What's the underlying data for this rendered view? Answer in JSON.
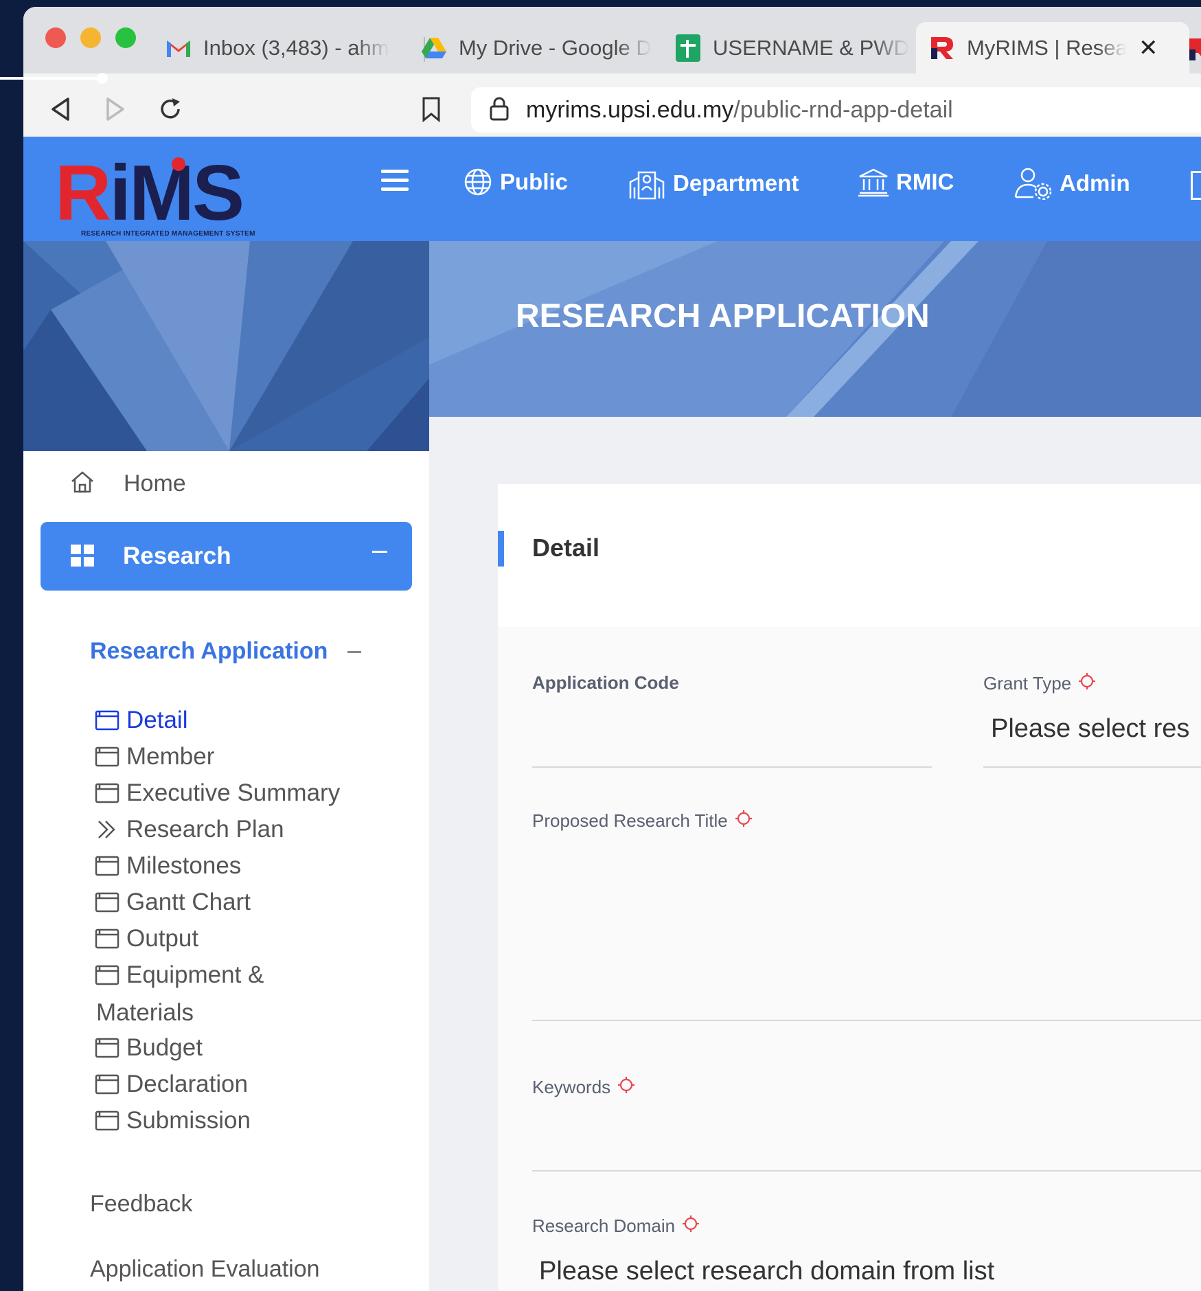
{
  "browser": {
    "tabs": [
      {
        "label": "Inbox (3,483) - ahm",
        "icon": "gmail-icon",
        "active": false
      },
      {
        "label": "My Drive - Google D",
        "icon": "google-drive-icon",
        "active": false
      },
      {
        "label": "USERNAME & PWD",
        "icon": "google-sheets-icon",
        "active": false
      },
      {
        "label": "MyRIMS | Resea",
        "icon": "rims-icon",
        "active": true
      }
    ],
    "url_host": "myrims.upsi.edu.my",
    "url_path": "/public-rnd-app-detail"
  },
  "header": {
    "logo_text_r": "R",
    "logo_text_rest": "iMS",
    "logo_subtitle": "RESEARCH INTEGRATED MANAGEMENT SYSTEM",
    "nav": [
      {
        "label": "Public",
        "icon": "globe-icon"
      },
      {
        "label": "Department",
        "icon": "department-icon"
      },
      {
        "label": "RMIC",
        "icon": "bank-icon"
      },
      {
        "label": "Admin",
        "icon": "admin-user-icon"
      }
    ],
    "brand_color": "#4287ef"
  },
  "hero": {
    "title": "RESEARCH APPLICATION"
  },
  "sidebar": {
    "home": "Home",
    "research": "Research",
    "research_application": "Research Application",
    "items": [
      {
        "label": "Detail",
        "active": true
      },
      {
        "label": "Member"
      },
      {
        "label": "Executive Summary"
      },
      {
        "label": "Research Plan",
        "icon": "double-chevron-icon"
      },
      {
        "label": "Milestones"
      },
      {
        "label": "Gantt Chart"
      },
      {
        "label": "Output"
      },
      {
        "label": "Equipment &"
      },
      {
        "label": "Budget"
      },
      {
        "label": "Declaration"
      },
      {
        "label": "Submission"
      }
    ],
    "equipment_wrap": "Materials",
    "feedback": "Feedback",
    "application_evaluation": "Application Evaluation"
  },
  "form": {
    "section_title": "Detail",
    "application_code_label": "Application Code",
    "grant_type_label": "Grant Type",
    "grant_type_placeholder": "Please select res",
    "title_label": "Proposed Research Title",
    "keywords_label": "Keywords",
    "domain_label": "Research Domain",
    "domain_placeholder": "Please select research domain from list"
  }
}
